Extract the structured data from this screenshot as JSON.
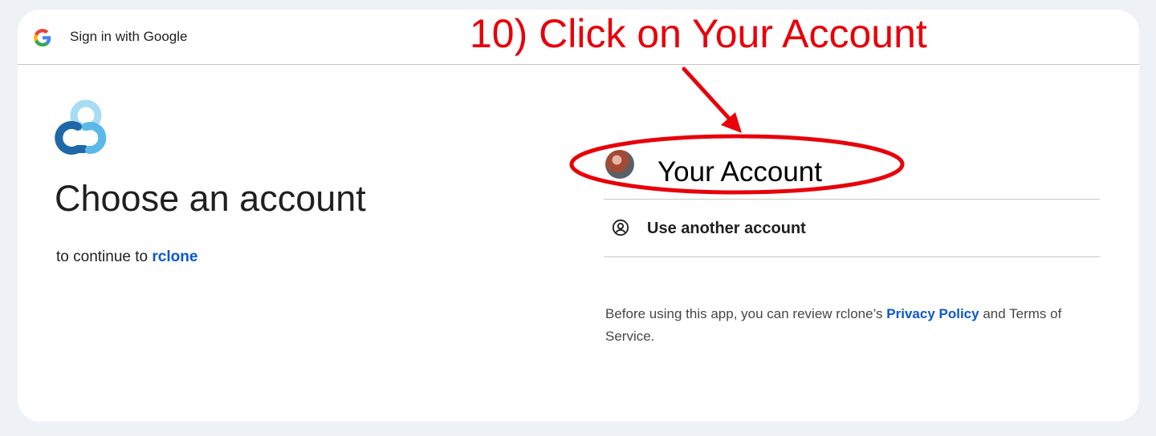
{
  "header": {
    "title": "Sign in with Google",
    "logo_icon": "google-g-icon"
  },
  "annotation": {
    "instruction": "10)  Click on Your Account",
    "color": "#e8000a"
  },
  "main": {
    "app_logo_icon": "rclone-logo",
    "title": "Choose an account",
    "subtitle_prefix": "to continue to",
    "app_name": "rclone"
  },
  "accounts": {
    "selected_name": "Your Account",
    "another_label": "Use another account",
    "another_icon": "person-circle-icon"
  },
  "footer": {
    "text_before": "Before using this app, you can review rclone’s",
    "privacy_link": "Privacy Policy",
    "text_after": "and Terms of Service."
  },
  "colors": {
    "link": "#0b57d0",
    "background": "#eef1f6",
    "card": "#ffffff"
  }
}
